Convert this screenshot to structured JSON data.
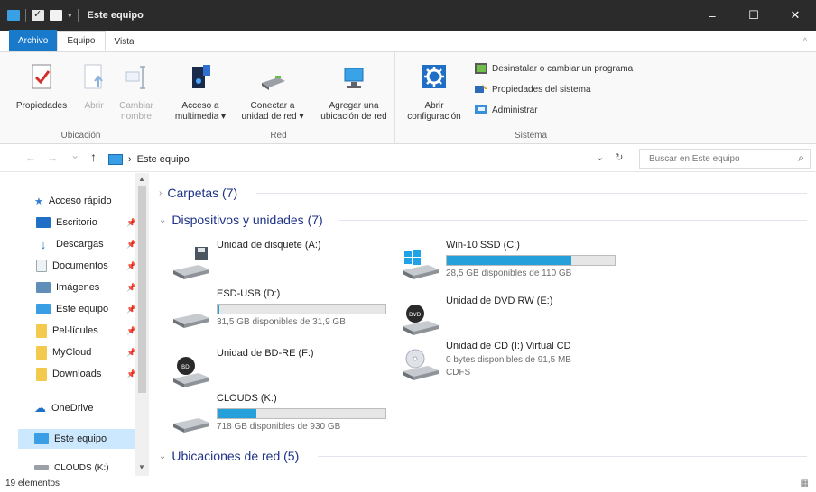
{
  "window": {
    "title": "Este equipo",
    "minimize": "–",
    "maximize": "☐",
    "close": "✕"
  },
  "tabs": [
    "Archivo",
    "Equipo",
    "Vista"
  ],
  "ribbon": {
    "groups": {
      "location": {
        "label": "Ubicación",
        "buttons": [
          "Propiedades",
          "Abrir",
          "Cambiar\nnombre"
        ]
      },
      "network": {
        "label": "Red",
        "buttons": [
          "Acceso a\nmultimedia ▾",
          "Conectar a\nunidad de red ▾",
          "Agregar una\nubicación de red"
        ]
      },
      "system": {
        "label": "Sistema",
        "open_settings": "Abrir\nconfiguración",
        "commands": [
          "Desinstalar o cambiar un programa",
          "Propiedades del sistema",
          "Administrar"
        ]
      }
    }
  },
  "address": {
    "back": "←",
    "forward": "→",
    "recent": "⌄",
    "up": "↑",
    "path": [
      "Este equipo"
    ],
    "dropdown": "⌄",
    "refresh": "↻",
    "search_placeholder": "Buscar en Este equipo"
  },
  "navpane": {
    "items": [
      {
        "label": "Acceso rápido",
        "icon": "star-icon",
        "pinned": false
      },
      {
        "label": "Escritorio",
        "icon": "desktop-icon",
        "pinned": true
      },
      {
        "label": "Descargas",
        "icon": "download-icon",
        "pinned": true
      },
      {
        "label": "Documentos",
        "icon": "document-icon",
        "pinned": true
      },
      {
        "label": "Imágenes",
        "icon": "pictures-icon",
        "pinned": true
      },
      {
        "label": "Este equipo",
        "icon": "computer-icon",
        "pinned": true
      },
      {
        "label": "Pel·lícules",
        "icon": "folder-icon",
        "pinned": true
      },
      {
        "label": "MyCloud",
        "icon": "folder-icon",
        "pinned": true
      },
      {
        "label": "Downloads",
        "icon": "folder-icon",
        "pinned": true
      },
      {
        "label": "OneDrive",
        "icon": "cloud-icon",
        "pinned": false
      },
      {
        "label": "Este equipo",
        "icon": "computer-icon",
        "pinned": false,
        "selected": true
      },
      {
        "label": "CLOUDS (K:)",
        "icon": "drive-icon",
        "pinned": false
      }
    ]
  },
  "content": {
    "sections": {
      "folders": "Carpetas (7)",
      "devices": "Dispositivos y unidades (7)",
      "network": "Ubicaciones de red (5)"
    },
    "drives": [
      {
        "name": "Unidad de disquete (A:)",
        "icon": "floppy-drive-icon"
      },
      {
        "name": "Win-10 SSD (C:)",
        "icon": "windows-drive-icon",
        "used_fraction": 0.74,
        "free": "28,5 GB disponibles de 110 GB"
      },
      {
        "name": "ESD-USB (D:)",
        "icon": "usb-drive-icon",
        "used_fraction": 0.01,
        "free": "31,5 GB disponibles de 31,9 GB"
      },
      {
        "name": "Unidad de DVD RW (E:)",
        "icon": "dvd-drive-icon"
      },
      {
        "name": "Unidad de BD-RE (F:)",
        "icon": "bd-drive-icon"
      },
      {
        "name": "Unidad de CD (I:) Virtual CD",
        "icon": "cd-drive-icon",
        "free": "0 bytes disponibles de 91,5 MB",
        "fs": "CDFS"
      },
      {
        "name": "CLOUDS (K:)",
        "icon": "cloud-drive-icon",
        "used_fraction": 0.23,
        "free": "718 GB disponibles de 930 GB"
      }
    ]
  },
  "status": {
    "count": "19 elementos"
  },
  "colors": {
    "accent": "#1979ca",
    "bar_fill": "#26a0da",
    "selection": "#cce8ff",
    "section_heading": "#1e3287"
  }
}
